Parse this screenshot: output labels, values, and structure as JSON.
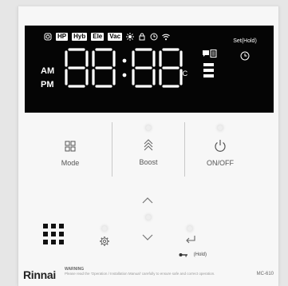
{
  "display": {
    "chips": [
      "HP",
      "Hyb",
      "Ele",
      "Vac"
    ],
    "am": "AM",
    "pm": "PM",
    "digits": "88:88",
    "unit": "°C",
    "set_label": "Set(Hold)"
  },
  "buttons": {
    "mode": "Mode",
    "boost": "Boost",
    "onoff": "ON/OFF",
    "hold": "(Hold)"
  },
  "footer": {
    "brand": "Rinnai",
    "warning_title": "WARNING",
    "warning_text": "Please read the 'Operation / Installation Manual' carefully to ensure safe and correct operation.",
    "model": "MC-610"
  },
  "colors": {
    "screen": "#050505",
    "segment": "#ffffff",
    "panel": "#f7f7f7",
    "button_icon": "#555555"
  },
  "icons": [
    "cycle-icon",
    "sun-icon",
    "lock-icon",
    "clock-icon",
    "wifi-icon",
    "gear-icon",
    "grid-icon",
    "enter-icon",
    "key-icon",
    "power-icon"
  ]
}
